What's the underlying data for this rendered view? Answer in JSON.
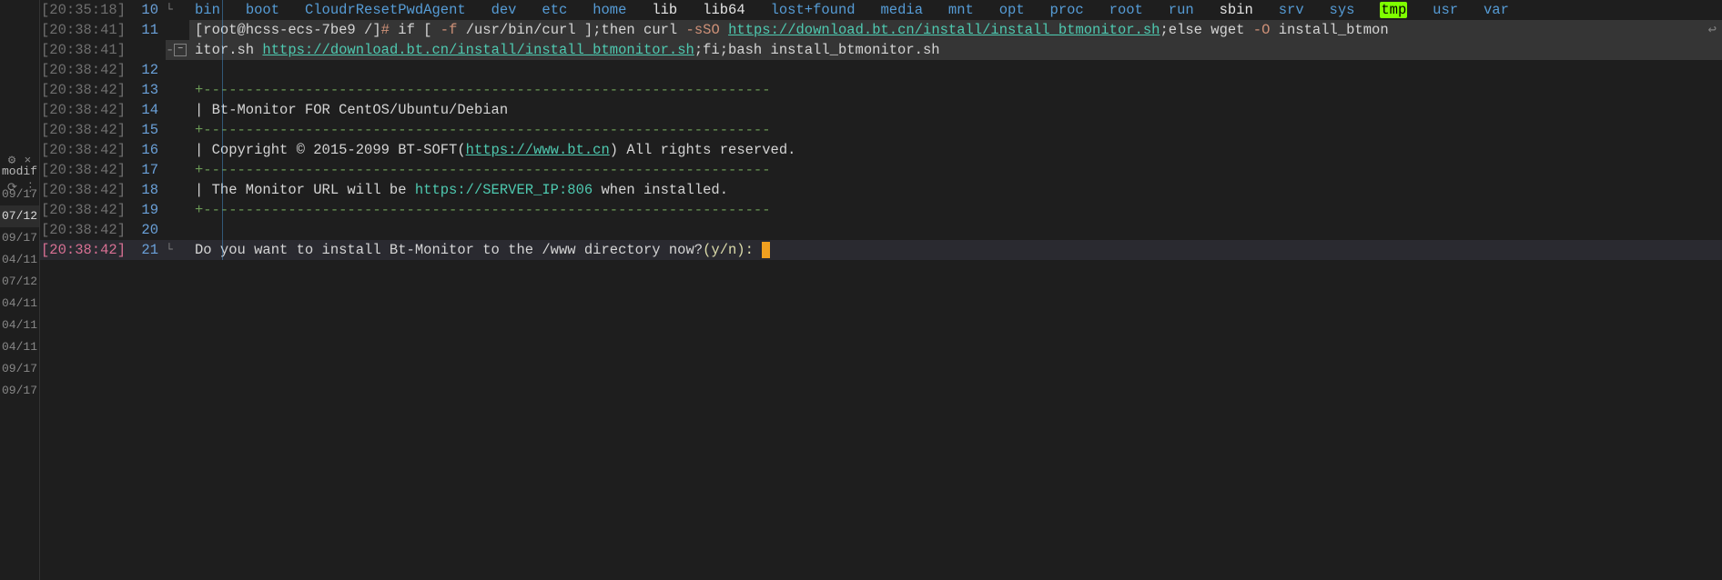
{
  "left_panel": {
    "gear": "⚙",
    "close": "×",
    "spinner": "⟳",
    "more": "⋮",
    "modif": "modif",
    "dates": [
      "09/17",
      "07/12",
      "09/17",
      "04/11",
      "07/12",
      "04/11",
      "04/11",
      "04/11",
      "09/17",
      "09/17"
    ]
  },
  "timestamps": [
    "[20:35:18]",
    "[20:38:41]",
    "[20:38:41]",
    "[20:38:42]",
    "[20:38:42]",
    "[20:38:42]",
    "[20:38:42]",
    "[20:38:42]",
    "[20:38:42]",
    "[20:38:42]",
    "[20:38:42]",
    "[20:38:42]"
  ],
  "line_numbers": [
    "10",
    "11",
    "",
    "12",
    "13",
    "14",
    "15",
    "16",
    "17",
    "18",
    "19",
    "20",
    "21"
  ],
  "ls": {
    "bin": "bin",
    "boot": "boot",
    "agent": "CloudrResetPwdAgent",
    "dev": "dev",
    "etc": "etc",
    "home": "home",
    "lib": "lib",
    "lib64": "lib64",
    "lost": "lost+found",
    "media": "media",
    "mnt": "mnt",
    "opt": "opt",
    "proc": "proc",
    "root": "root",
    "run": "run",
    "sbin": "sbin",
    "srv": "srv",
    "sys": "sys",
    "tmp": "tmp",
    "usr": "usr",
    "var": "var"
  },
  "cmd": {
    "prompt": "[root@hcss-ecs-7be9 /]",
    "hash": "#",
    "sp": " ",
    "p1": "if [ ",
    "flag_f": "-f",
    "p2": " /usr/bin/curl ];then curl ",
    "flag_s": "-sSO",
    "url1": "https://download.bt.cn/install/install_btmonitor.sh",
    "p3": ";else wget ",
    "flag_o": "-O",
    "p4": " install_btmon",
    "wrap": "↩",
    "p5": "itor.sh ",
    "p6": ";fi;bash install_btmonitor.sh"
  },
  "banner": {
    "top": "+-------------------------------------------------------------------",
    "l1": "| Bt-Monitor FOR CentOS/Ubuntu/Debian",
    "sep": "+-------------------------------------------------------------------",
    "l2a": "| Copyright © 2015-2099 BT-SOFT(",
    "l2url": "https://www.bt.cn",
    "l2b": ") All rights reserved.",
    "l3a": "| The Monitor URL will be ",
    "l3url": "https://SERVER_IP:806",
    "l3b": " when installed.",
    "bot": "+-------------------------------------------------------------------"
  },
  "prompt": {
    "q": "Do you want to install Bt-Monitor to the /www directory now?",
    "yn": "(y/n): "
  },
  "fold_dash": "-"
}
